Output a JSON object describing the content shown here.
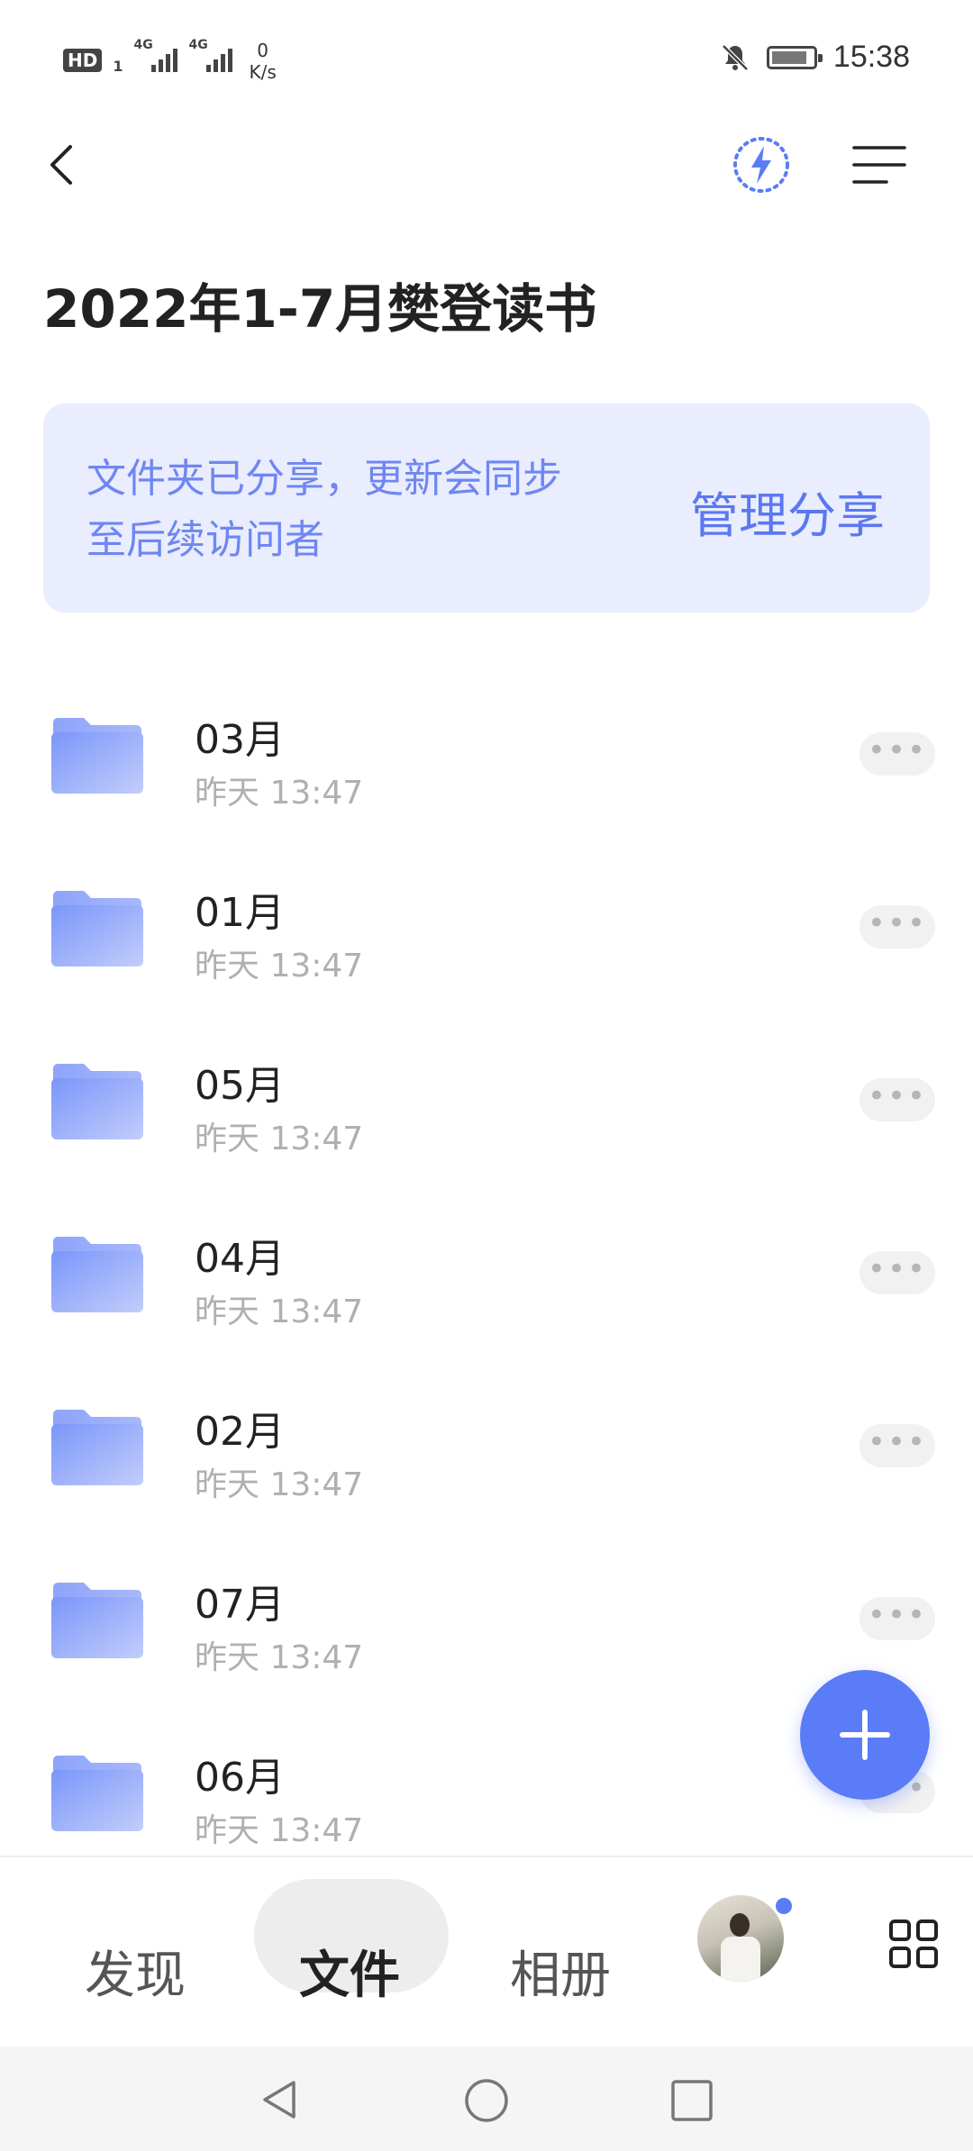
{
  "status_bar": {
    "network_badge": "HD",
    "network_badge_sub": "1",
    "signal1_label": "4G",
    "signal2_label": "4G",
    "speed_value": "0",
    "speed_unit": "K/s",
    "time": "15:38"
  },
  "header": {
    "title": "2022年1-7月樊登读书",
    "icons": [
      "back-icon",
      "lightning-icon",
      "menu-icon"
    ]
  },
  "share_banner": {
    "message_line1": "文件夹已分享，更新会同步",
    "message_line2": "至后续访问者",
    "action_label": "管理分享"
  },
  "files": [
    {
      "name": "03月",
      "time": "昨天 13:47"
    },
    {
      "name": "01月",
      "time": "昨天 13:47"
    },
    {
      "name": "05月",
      "time": "昨天 13:47"
    },
    {
      "name": "04月",
      "time": "昨天 13:47"
    },
    {
      "name": "02月",
      "time": "昨天 13:47"
    },
    {
      "name": "07月",
      "time": "昨天 13:47"
    },
    {
      "name": "06月",
      "time": "昨天 13:47"
    }
  ],
  "more_label": "•••",
  "bottom_nav": {
    "tabs": [
      {
        "label": "发现"
      },
      {
        "label": "文件"
      },
      {
        "label": "相册"
      }
    ],
    "active_tab": "文件"
  },
  "colors": {
    "accent": "#5a7cf6",
    "banner_bg": "#e9edfd",
    "banner_text": "#6f86f2"
  }
}
